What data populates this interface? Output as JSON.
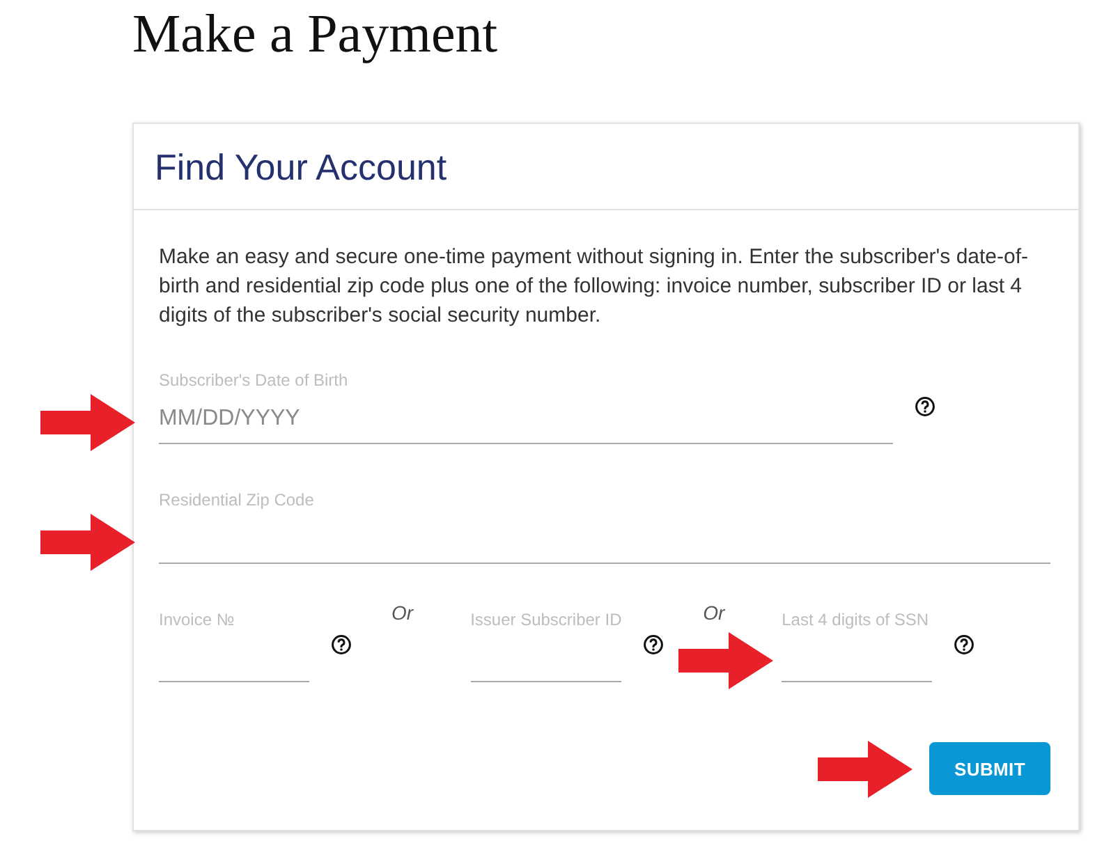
{
  "page": {
    "title": "Make a Payment"
  },
  "card": {
    "title": "Find Your Account",
    "intro": "Make an easy and secure one-time payment without signing in. Enter the subscriber's date-of-birth and residential zip code plus one of the following: invoice number, subscriber ID or last 4 digits of the subscriber's social security number.",
    "fields": [
      {
        "label": "Subscriber's Date of Birth",
        "placeholder": "MM/DD/YYYY",
        "help": true,
        "marked": true
      },
      {
        "label": "Residential Zip Code",
        "help": false,
        "marked": true
      }
    ],
    "alternatives": [
      {
        "label": "Invoice №",
        "help": true,
        "marked": false
      },
      {
        "joiner": "Or",
        "label": "Issuer Subscriber ID",
        "help": true,
        "marked": false
      },
      {
        "joiner": "Or",
        "label": "Last 4 digits of SSN",
        "help": true,
        "marked": true
      }
    ],
    "submit": {
      "label": "SUBMIT",
      "marked": true
    }
  }
}
